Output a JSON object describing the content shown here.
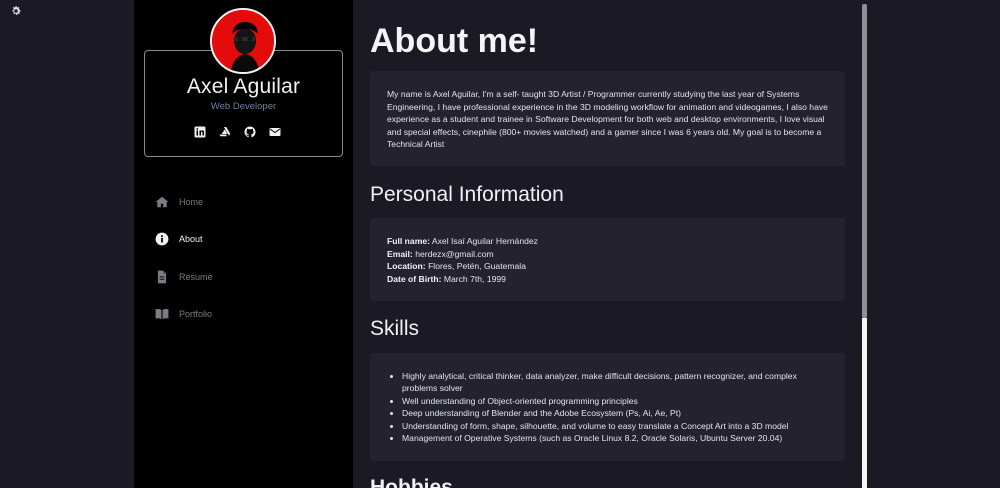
{
  "profile": {
    "name": "Axel Aguilar",
    "role": "Web Developer"
  },
  "socials": [
    {
      "icon": "linkedin-icon"
    },
    {
      "icon": "artstation-icon"
    },
    {
      "icon": "github-icon"
    },
    {
      "icon": "mail-icon"
    }
  ],
  "nav": {
    "home": "Home",
    "about": "About",
    "resume": "Resume",
    "portfolio": "Portfolio",
    "active": "about"
  },
  "main": {
    "title": "About me!",
    "about_text": "My name is Axel Aguilar, I'm a self- taught 3D Artist / Programmer currently studying the last year of Systems Engineering, I have professional experience in the 3D modeling workflow for animation and videogames, I also have experience as a student and trainee in Software Development for both web and desktop environments, I love visual and special effects, cinephile (800+ movies watched) and a gamer since I was 6 years old. My goal is to become a Technical Artist",
    "personal_heading": "Personal Information",
    "personal": {
      "fullname_label": "Full name:",
      "fullname": "Axel Isaí Aguilar Hernández",
      "email_label": "Email:",
      "email": "herdezx@gmail.com",
      "location_label": "Location:",
      "location": "Flores, Petén, Guatemala",
      "dob_label": "Date of Birth:",
      "dob": "March 7th, 1999"
    },
    "skills_heading": "Skills",
    "skills": [
      "Highly analytical, critical thinker, data analyzer, make difficult decisions, pattern recognizer, and complex problems solver",
      "Well understanding of Object-oriented programming principles",
      "Deep understanding of Blender and the Adobe Ecosystem (Ps, Ai, Ae, Pt)",
      "Understanding of form, shape, silhouette, and volume to easy translate a Concept Art into a 3D model",
      "Management of Operative Systems (such as Oracle Linux 8.2, Oracle Solaris, Ubuntu Server 20.04)"
    ],
    "hobbies_heading": "Hobbies"
  },
  "colors": {
    "accent_red": "#e30b0b",
    "sidebar_bg": "#000000",
    "main_bg": "#1b1a24",
    "card_bg": "#23222e",
    "role_color": "#6f7fa0"
  }
}
